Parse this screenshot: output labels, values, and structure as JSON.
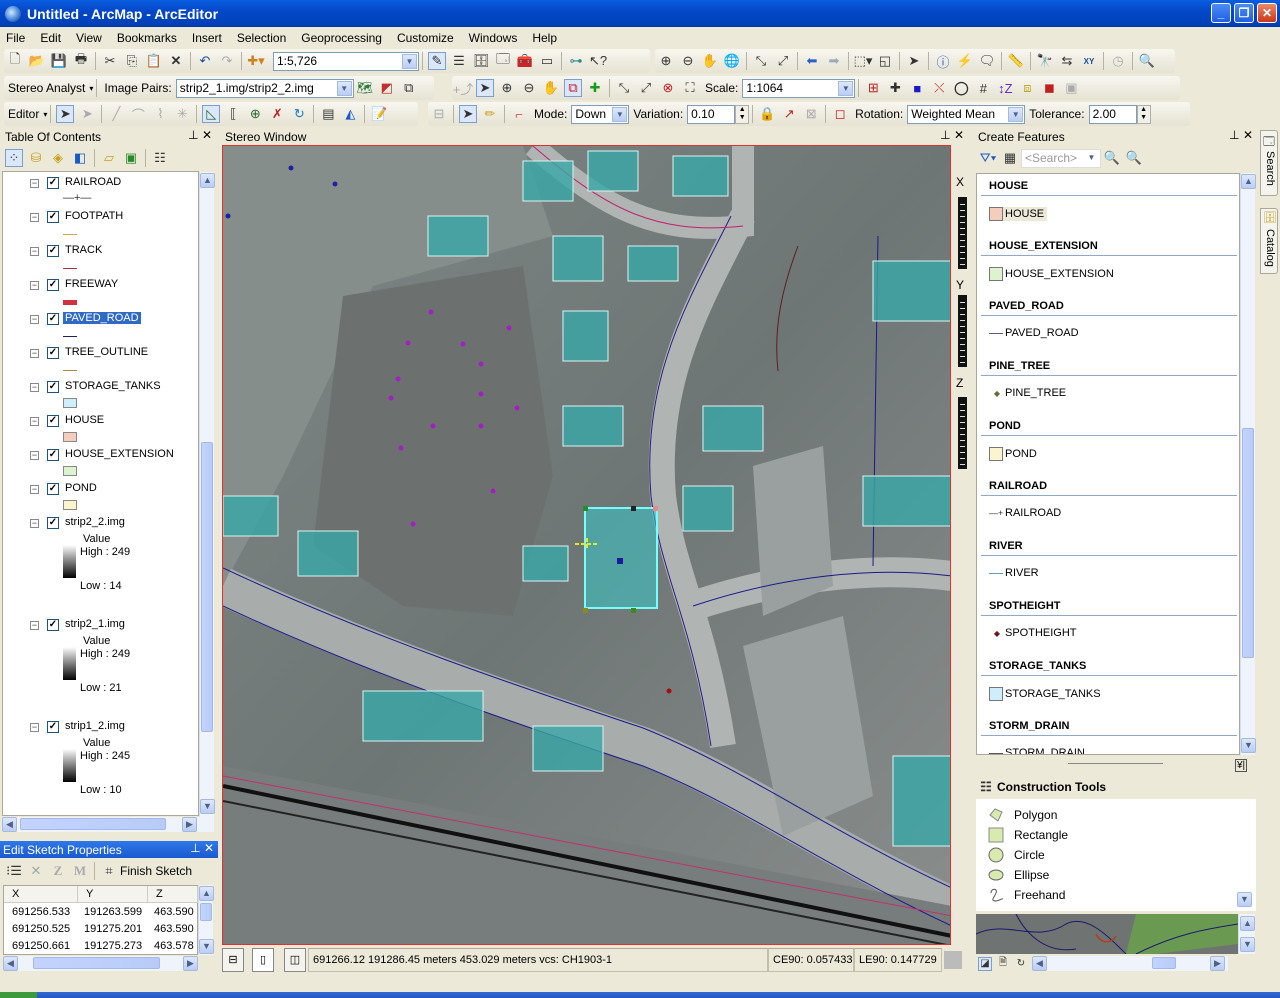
{
  "window": {
    "title": "Untitled - ArcMap - ArcEditor",
    "minimize": "_",
    "restore": "❐",
    "close": "✕"
  },
  "menu": [
    "File",
    "Edit",
    "View",
    "Bookmarks",
    "Insert",
    "Selection",
    "Geoprocessing",
    "Customize",
    "Windows",
    "Help"
  ],
  "toolbar_standard": {
    "map_scale": "1:5,726"
  },
  "toolbar_stereo": {
    "menu_label": "Stereo Analyst",
    "image_pairs_label": "Image Pairs:",
    "image_pairs_value": "strip2_1.img/strip2_2.img",
    "scale_label": "Scale:",
    "scale_value": "1:1064"
  },
  "toolbar_editor": {
    "menu_label": "Editor",
    "mode_label": "Mode:",
    "mode_value": "Down",
    "variation_label": "Variation:",
    "variation_value": "0.10",
    "rotation_label": "Rotation:",
    "rotation_value": "Weighted Mean",
    "tolerance_label": "Tolerance:",
    "tolerance_value": "2.00"
  },
  "toc": {
    "title": "Table Of Contents",
    "layers": [
      {
        "name": "RAILROAD",
        "symbol": "railroad",
        "color": "#333333"
      },
      {
        "name": "FOOTPATH",
        "symbol": "line",
        "color": "#c8a850"
      },
      {
        "name": "TRACK",
        "symbol": "line",
        "color": "#a03040"
      },
      {
        "name": "FREEWAY",
        "symbol": "thickline",
        "color": "#d03040"
      },
      {
        "name": "PAVED_ROAD",
        "symbol": "line",
        "color": "#202060",
        "selected": true
      },
      {
        "name": "TREE_OUTLINE",
        "symbol": "line",
        "color": "#b08840"
      },
      {
        "name": "STORAGE_TANKS",
        "symbol": "fill",
        "color": "#cdeefa"
      },
      {
        "name": "HOUSE",
        "symbol": "fill",
        "color": "#f4cdbd"
      },
      {
        "name": "HOUSE_EXTENSION",
        "symbol": "fill",
        "color": "#dff2cf"
      },
      {
        "name": "POND",
        "symbol": "fill",
        "color": "#fbf4cf"
      }
    ],
    "rasters": [
      {
        "name": "strip2_2.img",
        "value_label": "Value",
        "high": "High : 249",
        "low": "Low : 14"
      },
      {
        "name": "strip2_1.img",
        "value_label": "Value",
        "high": "High : 249",
        "low": "Low : 21"
      },
      {
        "name": "strip1_2.img",
        "value_label": "Value",
        "high": "High : 245",
        "low": "Low : 10"
      }
    ]
  },
  "sketch": {
    "title": "Edit Sketch Properties",
    "finish_label": "Finish Sketch",
    "columns": [
      "X",
      "Y",
      "Z"
    ],
    "rows": [
      [
        "691256.533",
        "191263.599",
        "463.590"
      ],
      [
        "691250.525",
        "191275.201",
        "463.590"
      ],
      [
        "691250.661",
        "191275.273",
        "463.578"
      ]
    ]
  },
  "stereo": {
    "title": "Stereo Window",
    "axes": [
      "X",
      "Y",
      "Z"
    ]
  },
  "statusbar": {
    "coords": "691266.12  191286.45 meters  453.029 meters  vcs: CH1903-1",
    "ce90": "CE90: 0.057433",
    "le90": "LE90: 0.147729"
  },
  "create_features": {
    "title": "Create Features",
    "search_placeholder": "<Search>",
    "groups": [
      {
        "header": "HOUSE",
        "item": "HOUSE",
        "symbol": "fill",
        "color": "#f4cdbd",
        "selected": true
      },
      {
        "header": "HOUSE_EXTENSION",
        "item": "HOUSE_EXTENSION",
        "symbol": "fill",
        "color": "#dff2cf"
      },
      {
        "header": "PAVED_ROAD",
        "item": "PAVED_ROAD",
        "symbol": "line",
        "color": "#5a5a8a"
      },
      {
        "header": "PINE_TREE",
        "item": "PINE_TREE",
        "symbol": "point",
        "color": "#6b6b3a"
      },
      {
        "header": "POND",
        "item": "POND",
        "symbol": "fill",
        "color": "#fbf4cf"
      },
      {
        "header": "RAILROAD",
        "item": "RAILROAD",
        "symbol": "railroad",
        "color": "#333333"
      },
      {
        "header": "RIVER",
        "item": "RIVER",
        "symbol": "line",
        "color": "#5aa0c0"
      },
      {
        "header": "SPOTHEIGHT",
        "item": "SPOTHEIGHT",
        "symbol": "point",
        "color": "#6b1a1a"
      },
      {
        "header": "STORAGE_TANKS",
        "item": "STORAGE_TANKS",
        "symbol": "fill",
        "color": "#cdeefa"
      },
      {
        "header": "STORM_DRAIN",
        "item": "STORM_DRAIN",
        "symbol": "line",
        "color": "#555555"
      }
    ]
  },
  "construction_tools": {
    "title": "Construction Tools",
    "items": [
      "Polygon",
      "Rectangle",
      "Circle",
      "Ellipse",
      "Freehand"
    ]
  },
  "side_tabs": [
    "Search",
    "Catalog"
  ]
}
